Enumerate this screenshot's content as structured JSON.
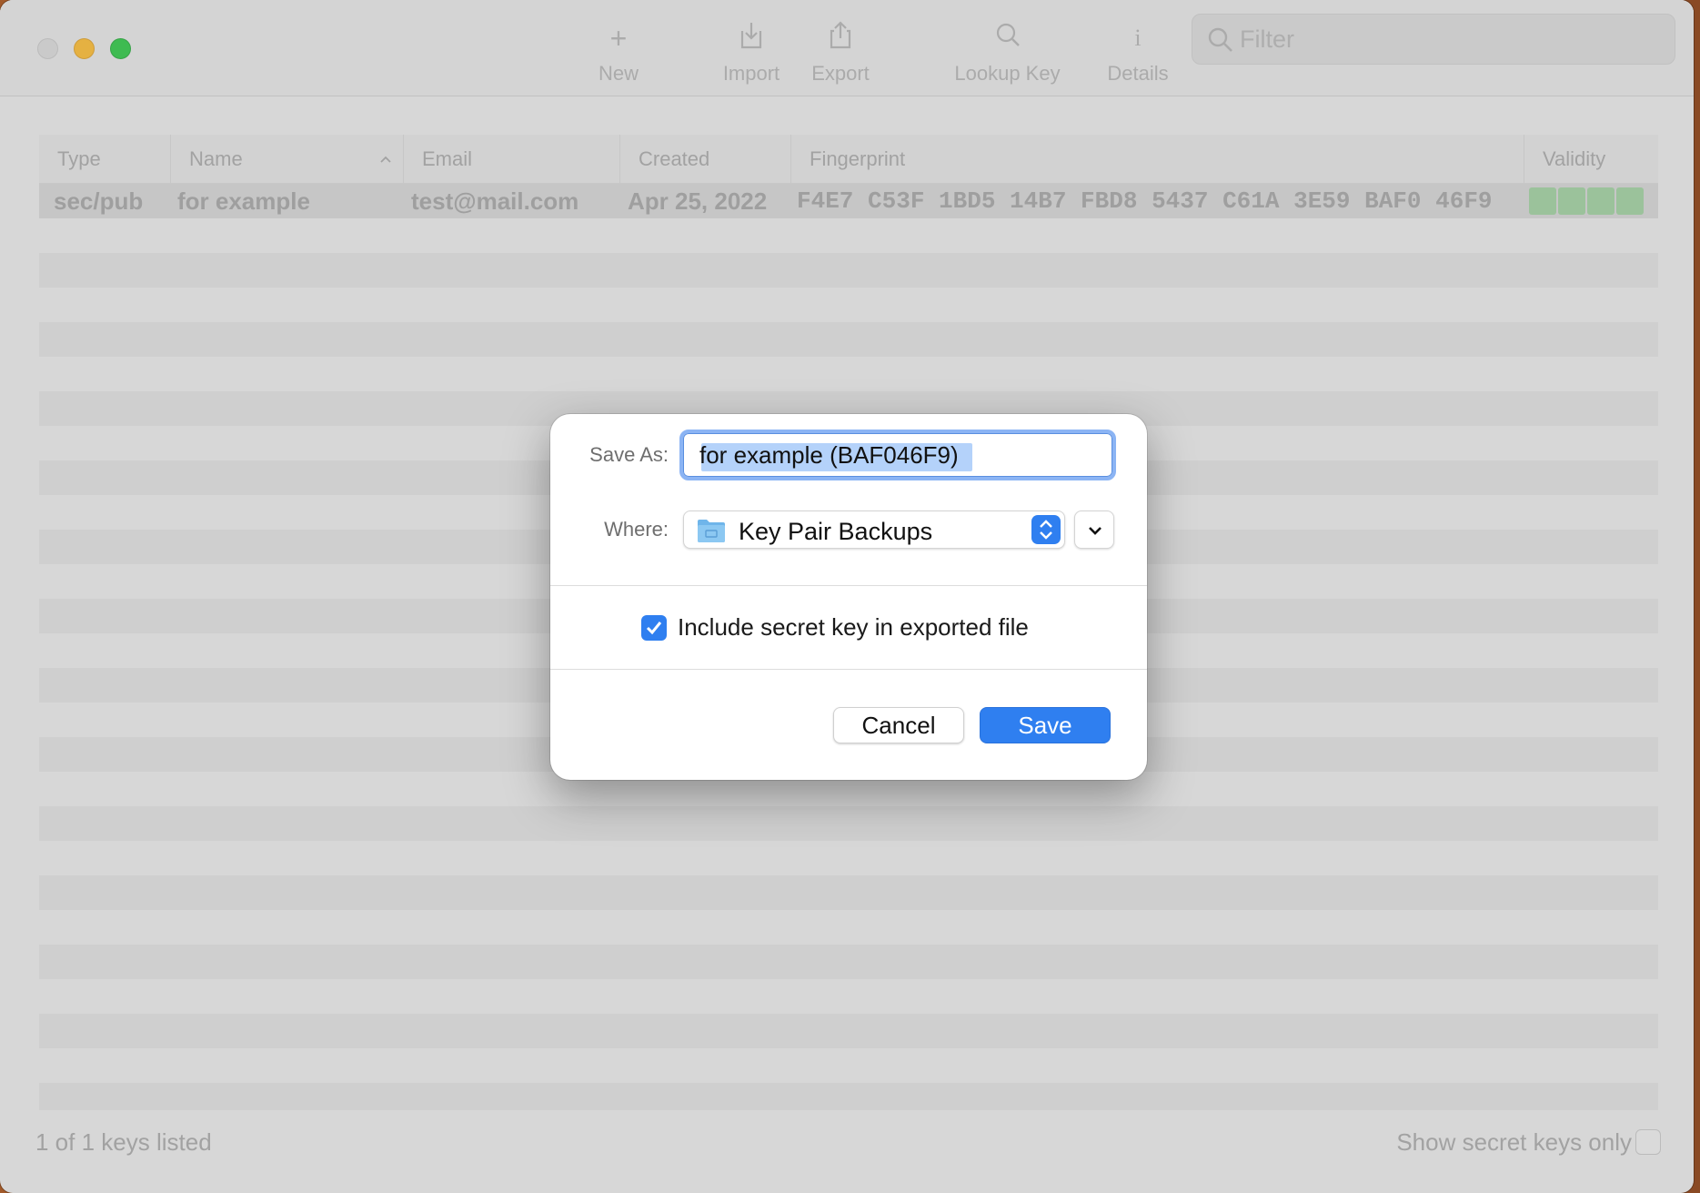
{
  "toolbar": {
    "new_label": "New",
    "import_label": "Import",
    "export_label": "Export",
    "lookup_label": "Lookup Key",
    "details_label": "Details",
    "details_glyph": "i",
    "new_glyph": "+",
    "filter_placeholder": "Filter"
  },
  "table": {
    "columns": [
      "Type",
      "Name",
      "Email",
      "Created",
      "Fingerprint",
      "Validity"
    ],
    "sort_column": "Name",
    "rows": [
      {
        "type": "sec/pub",
        "name": "for example",
        "email": "test@mail.com",
        "created": "Apr 25, 2022",
        "fingerprint": "F4E7 C53F 1BD5 14B7 FBD8  5437 C61A 3E59 BAF0 46F9",
        "validity_segments": 4,
        "validity_color": "#9fd19f"
      }
    ]
  },
  "footer": {
    "status": "1 of 1 keys listed",
    "show_secret_label": "Show secret keys only"
  },
  "dialog": {
    "save_as_label": "Save As:",
    "save_as_value": "for example (BAF046F9)",
    "where_label": "Where:",
    "where_value": "Key Pair Backups",
    "include_secret_label": "Include secret key in exported file",
    "include_secret_checked": true,
    "cancel_label": "Cancel",
    "save_label": "Save"
  },
  "colors": {
    "accent": "#2f7ff0",
    "focus_ring": "#8bb4f4",
    "selection": "#b4d2fa"
  }
}
